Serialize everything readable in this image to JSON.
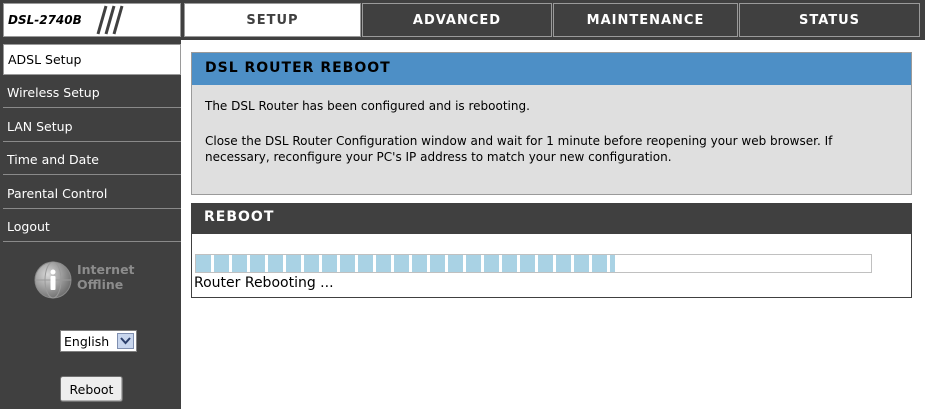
{
  "header": {
    "model": "DSL-2740B",
    "tabs": [
      {
        "label": "SETUP",
        "active": true
      },
      {
        "label": "ADVANCED",
        "active": false
      },
      {
        "label": "MAINTENANCE",
        "active": false
      },
      {
        "label": "STATUS",
        "active": false
      }
    ]
  },
  "sidebar": {
    "items": [
      {
        "label": "ADSL Setup",
        "active": true
      },
      {
        "label": "Wireless Setup",
        "active": false
      },
      {
        "label": "LAN Setup",
        "active": false
      },
      {
        "label": "Time and Date",
        "active": false
      },
      {
        "label": "Parental Control",
        "active": false
      },
      {
        "label": "Logout",
        "active": false
      }
    ],
    "internet_status_line1": "Internet",
    "internet_status_line2": "Offline",
    "language_selected": "English",
    "reboot_label": "Reboot"
  },
  "main": {
    "reboot_notice": {
      "title": "DSL ROUTER REBOOT",
      "line1": "The DSL Router has been configured and is rebooting.",
      "line2": "Close the DSL Router Configuration window and wait for 1 minute before reopening your web browser. If",
      "line3": "necessary, reconfigure your PC's IP address to match your new configuration."
    },
    "reboot_section": {
      "title": "REBOOT",
      "status_text": "Router Rebooting ...",
      "progress_fraction": 0.62
    }
  },
  "colors": {
    "dark_bg": "#404040",
    "panel_blue": "#4d8fc6",
    "panel_gray": "#dfdfdf",
    "progress_block": "#a9d2e4"
  },
  "icons": {
    "status": "globe-info-icon",
    "select_arrow": "chevron-down-icon"
  }
}
